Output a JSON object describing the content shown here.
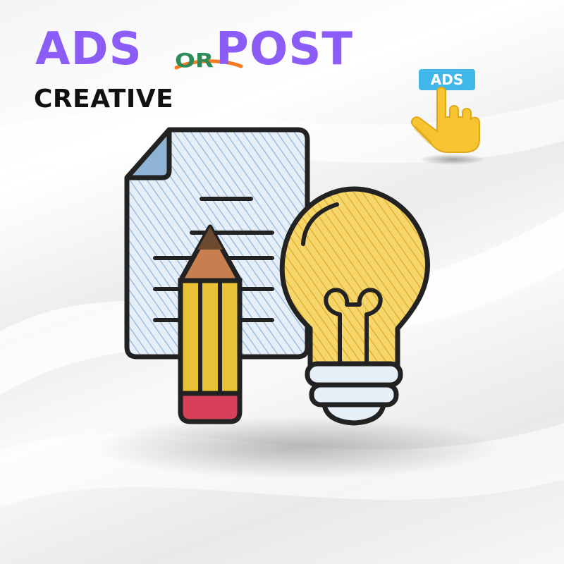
{
  "brand": {
    "word_ads": "ADS",
    "word_or": "OR",
    "word_post": "POST",
    "primary_color": "#8b5cf6",
    "or_color": "#2e8b57",
    "accent_swoosh_color": "#f47a20"
  },
  "subtitle": "CREATIVE",
  "ads_widget": {
    "tag_label": "ADS",
    "tag_color": "#3fb7e8",
    "hand_color": "#f7c531",
    "icon": "pointing-hand-icon"
  },
  "illustration": {
    "document_icon": "document-icon",
    "pencil_icon": "pencil-icon",
    "lightbulb_icon": "lightbulb-icon",
    "paper_color": "#cfe0f0",
    "bulb_color": "#f2c94c",
    "pencil_body_color": "#e9c237",
    "pencil_tip_color": "#c87f4f",
    "eraser_color": "#d8405a"
  }
}
